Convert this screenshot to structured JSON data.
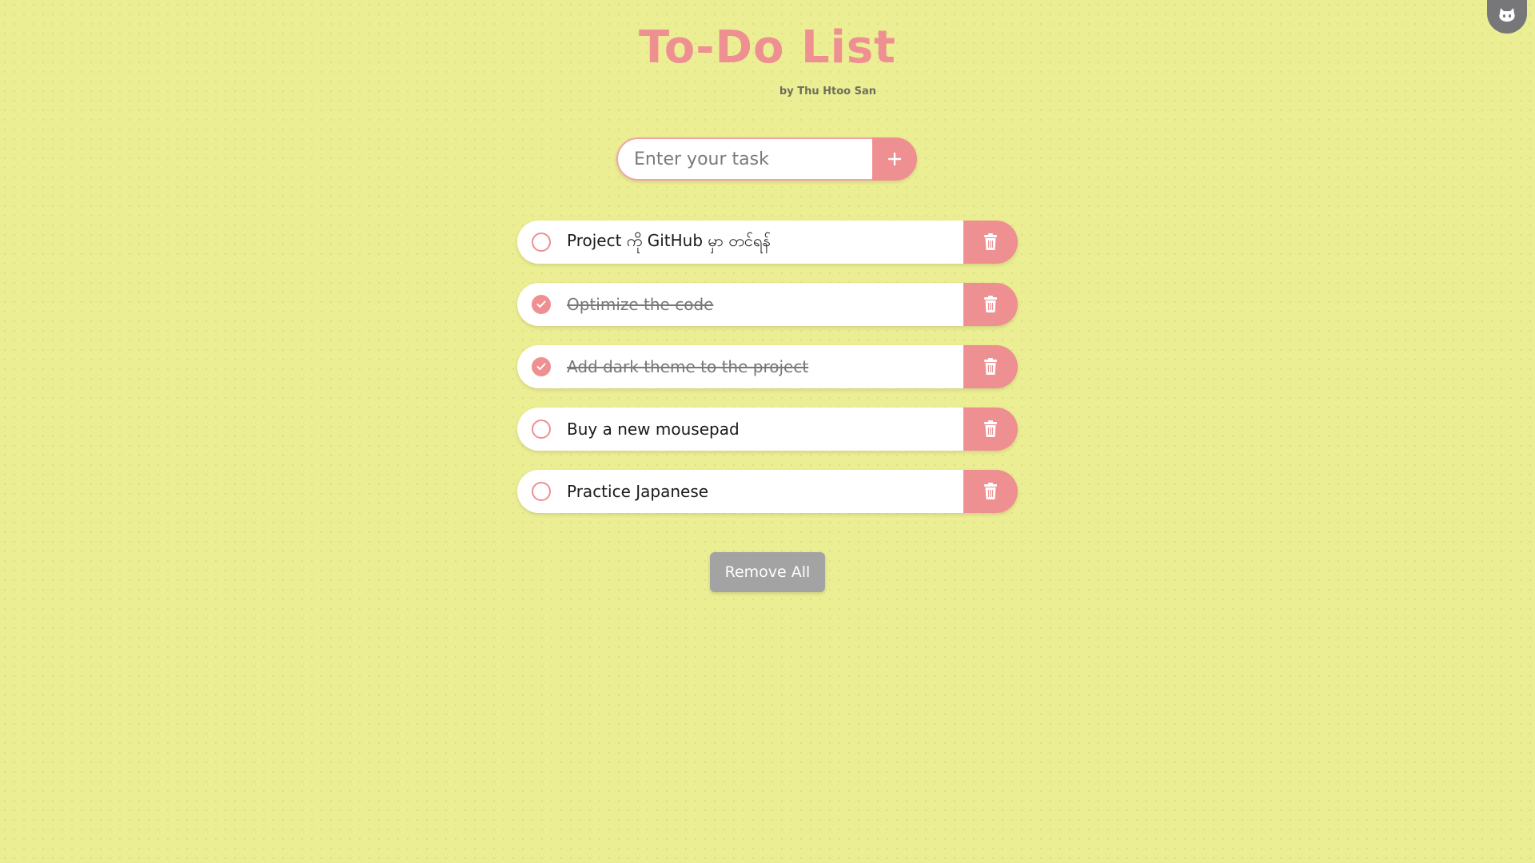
{
  "header": {
    "title": "To-Do List",
    "byline": "by Thu Htoo San"
  },
  "add_form": {
    "placeholder": "Enter your task",
    "value": ""
  },
  "tasks": [
    {
      "text": "Project ကို GitHub မှာ တင်ရန်",
      "done": false
    },
    {
      "text": "Optimize the code",
      "done": true
    },
    {
      "text": "Add dark theme to the project",
      "done": true
    },
    {
      "text": "Buy a new mousepad",
      "done": false
    },
    {
      "text": "Practice Japanese",
      "done": false
    }
  ],
  "footer": {
    "remove_all_label": "Remove All"
  },
  "colors": {
    "background": "#ecee93",
    "accent": "#ee8f92",
    "remove_all": "#a3a3a3"
  },
  "icons": {
    "github_corner": "github-icon",
    "add": "plus-icon",
    "delete": "trash-icon",
    "check": "check-icon"
  }
}
